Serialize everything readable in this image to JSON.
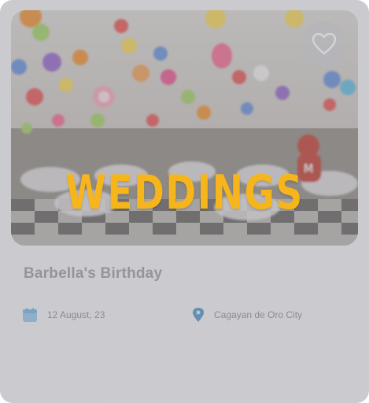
{
  "event": {
    "title": "Barbella's Birthday",
    "date": "12 August, 23",
    "location": "Cagayan de Oro City",
    "category": "WEDDINGS"
  },
  "icons": {
    "favorite": "heart-icon",
    "date": "calendar-icon",
    "location": "map-pin-icon"
  },
  "colors": {
    "category_text": "#f7b51c",
    "calendar": "#8ec5ea",
    "pin": "#4a92c9"
  }
}
